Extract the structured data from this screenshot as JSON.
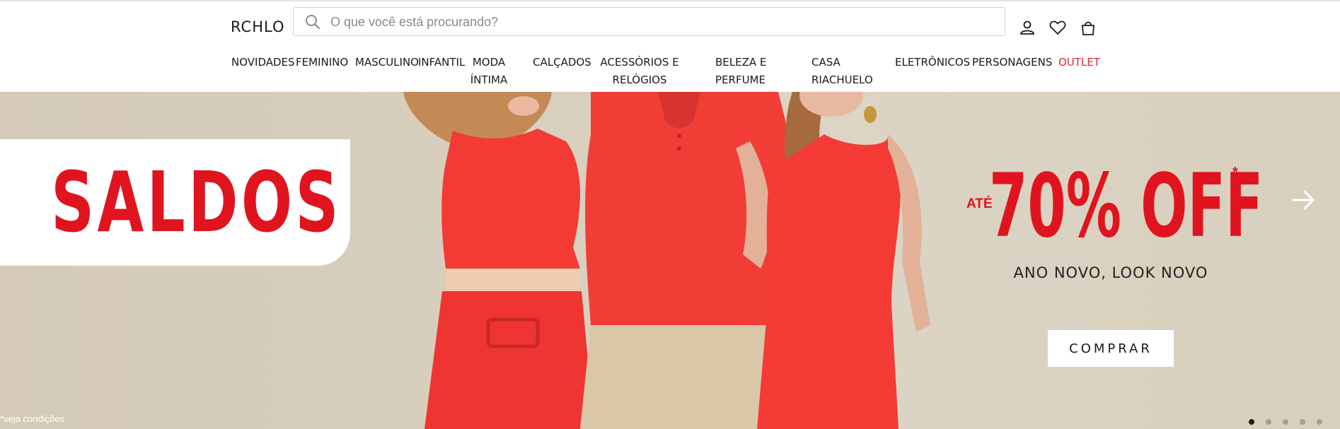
{
  "header": {
    "logo": "RCHLO",
    "search_placeholder": "O que você está procurando?",
    "icons": [
      "user-icon",
      "heart-icon",
      "bag-icon"
    ]
  },
  "nav": {
    "items": [
      {
        "label": "NOVIDADES",
        "color": "#1a1a1a"
      },
      {
        "label": "FEMININO",
        "color": "#1a1a1a"
      },
      {
        "label": "MASCULINO",
        "color": "#1a1a1a"
      },
      {
        "label": "INFANTIL",
        "color": "#1a1a1a"
      },
      {
        "label": "MODA ÍNTIMA",
        "color": "#1a1a1a"
      },
      {
        "label": "CALÇADOS",
        "color": "#1a1a1a"
      },
      {
        "label": "ACESSÓRIOS E RELÓGIOS",
        "color": "#1a1a1a"
      },
      {
        "label": "BELEZA E PERFUME",
        "color": "#1a1a1a"
      },
      {
        "label": "CASA RIACHUELO",
        "color": "#1a1a1a"
      },
      {
        "label": "ELETRÔNICOS",
        "color": "#1a1a1a"
      },
      {
        "label": "PERSONAGENS",
        "color": "#1a1a1a"
      },
      {
        "label": "OUTLET",
        "color": "#e0252f"
      }
    ]
  },
  "hero": {
    "headline": "SALDOS",
    "prefix": "ATÉ",
    "discount": "70% OFF",
    "asterisk": "*",
    "tagline": "ANO NOVO, LOOK NOVO",
    "cta_label": "COMPRAR",
    "terms": "*veja condições",
    "slide_count": 5,
    "active_slide": 1
  },
  "colors": {
    "brand_red": "#e0141e",
    "banner_bg": "#d8cfbe",
    "outfit_red": "#f33a35"
  }
}
